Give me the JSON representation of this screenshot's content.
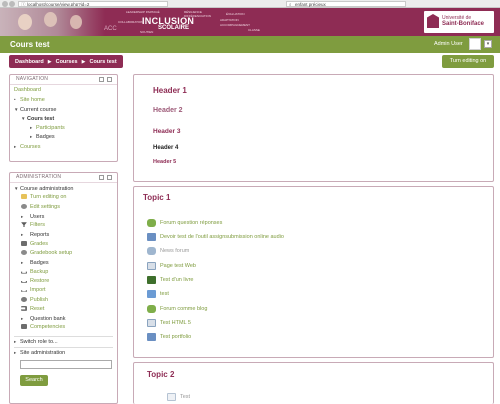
{
  "browser": {
    "url": "localhost/course/view.php?id=2",
    "search": "enfant précieux"
  },
  "banner": {
    "wordcloud_main": "INCLUSION",
    "wordcloud_sub": "SCOLAIRE",
    "wordcloud_small": [
      "LEADERSHIP PARTAGÉ",
      "RÉSILIENCE",
      "ÉVALUATION",
      "ADAPTATION",
      "ACCOMPAGNEMENT",
      "SOUTIEN",
      "DIFFÉRENCIATION",
      "COLLABORATION",
      "CLASSE",
      "ACC"
    ],
    "logo_line1": "Université de",
    "logo_line2": "Saint-Boniface"
  },
  "header": {
    "site_title": "Cours test",
    "user_name": "Admin User"
  },
  "breadcrumb": [
    "Dashboard",
    "Courses",
    "Cours test"
  ],
  "turn_editing_button": "Turn editing on",
  "navigation": {
    "title": "NAVIGATION",
    "items": [
      {
        "label": "Dashboard",
        "arrow": "",
        "style": "link"
      },
      {
        "label": "Site home",
        "arrow": "•",
        "style": "link"
      },
      {
        "label": "Current course",
        "arrow": "▼",
        "style": "dark"
      },
      {
        "label": "Cours test",
        "arrow": "▼",
        "style": "bold"
      },
      {
        "label": "Participants",
        "arrow": "▸",
        "style": "link"
      },
      {
        "label": "Badges",
        "arrow": "▸",
        "style": "dark"
      },
      {
        "label": "Courses",
        "arrow": "▸",
        "style": "link"
      }
    ]
  },
  "administration": {
    "title": "ADMINISTRATION",
    "course_admin": "Course administration",
    "items": [
      {
        "label": "Turn editing on",
        "icon": "pencil-icon"
      },
      {
        "label": "Edit settings",
        "icon": "gear-icon"
      },
      {
        "label": "Users",
        "icon": "arrow-right-icon"
      },
      {
        "label": "Filters",
        "icon": "filter-icon"
      },
      {
        "label": "Reports",
        "icon": "arrow-right-icon"
      },
      {
        "label": "Grades",
        "icon": "table-icon"
      },
      {
        "label": "Gradebook setup",
        "icon": "gear-icon"
      },
      {
        "label": "Badges",
        "icon": "arrow-right-icon"
      },
      {
        "label": "Backup",
        "icon": "upload-icon"
      },
      {
        "label": "Restore",
        "icon": "download-icon"
      },
      {
        "label": "Import",
        "icon": "import-icon"
      },
      {
        "label": "Publish",
        "icon": "publish-icon"
      },
      {
        "label": "Reset",
        "icon": "reset-icon"
      },
      {
        "label": "Question bank",
        "icon": "arrow-right-icon"
      },
      {
        "label": "Competencies",
        "icon": "competency-icon"
      }
    ],
    "switch_role": "Switch role to...",
    "site_admin": "Site administration",
    "search_button": "Search"
  },
  "summary": {
    "h1": "Header 1",
    "h2": "Header 2",
    "h3": "Header 3",
    "h4": "Header 4",
    "h5": "Header 5"
  },
  "topic1": {
    "title": "Topic 1",
    "activities": [
      {
        "label": "Forum question réponses",
        "icon": "forum-icon",
        "dim": false
      },
      {
        "label": "Devoir test de l'outil assignsubmission online audio",
        "icon": "assignment-icon",
        "dim": false
      },
      {
        "label": "News forum",
        "icon": "forum-icon",
        "dim": true
      },
      {
        "label": "Page test Web",
        "icon": "page-icon",
        "dim": false
      },
      {
        "label": "Test d'un livre",
        "icon": "book-icon",
        "dim": false
      },
      {
        "label": "test",
        "icon": "folder-icon",
        "dim": false
      },
      {
        "label": "Forum comme blog",
        "icon": "forum-icon",
        "dim": false
      },
      {
        "label": "Test HTML 5",
        "icon": "page-icon",
        "dim": false
      },
      {
        "label": "Test portfolio",
        "icon": "assignment-icon",
        "dim": false
      }
    ]
  },
  "topic2": {
    "title": "Topic 2",
    "activities": [
      {
        "label": "Test",
        "icon": "page-icon",
        "dim": true
      }
    ]
  },
  "colors": {
    "brand_maroon": "#8e2c54",
    "brand_green": "#7f9c3f"
  }
}
